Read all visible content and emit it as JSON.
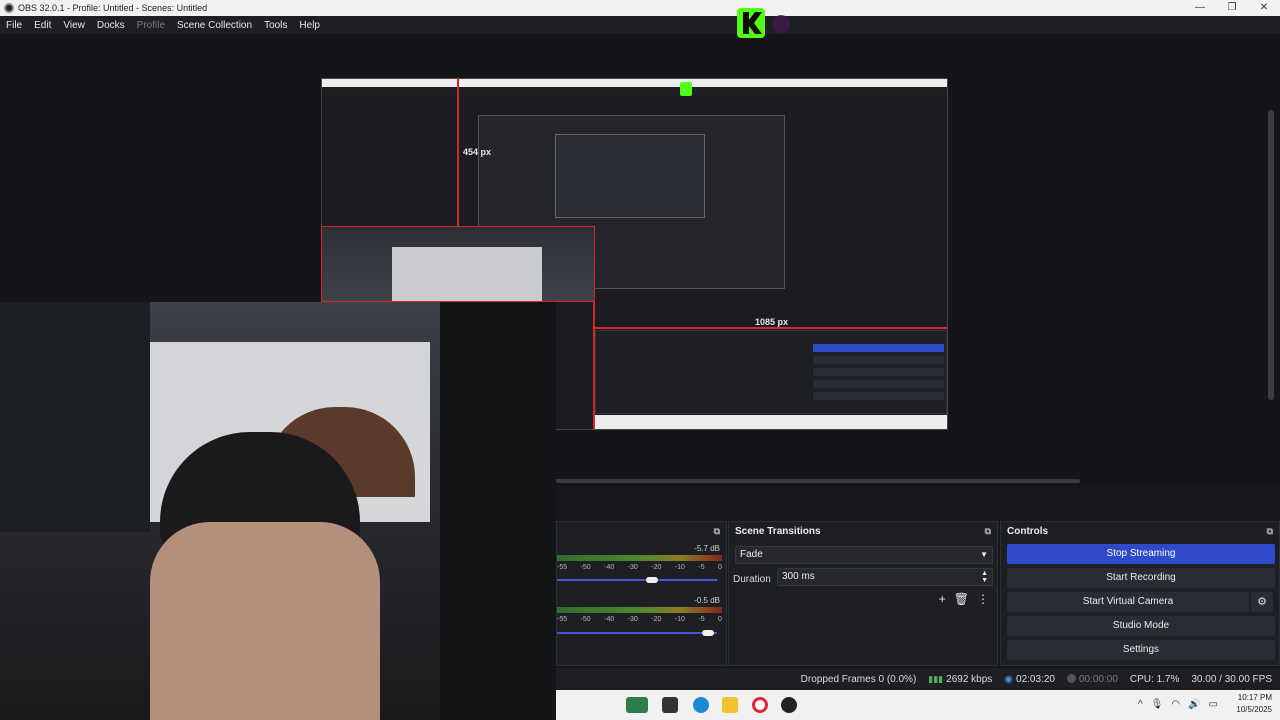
{
  "window": {
    "title": "OBS 32.0.1 - Profile: Untitled - Scenes: Untitled",
    "minimize": "—",
    "restore": "❐",
    "close": "✕"
  },
  "menu": [
    "File",
    "Edit",
    "View",
    "Docks",
    "Profile",
    "Scene Collection",
    "Tools",
    "Help"
  ],
  "preview": {
    "height_label": "454 px",
    "width_label": "1085 px"
  },
  "mixer": {
    "ticks": [
      "-55",
      "-50",
      "-40",
      "-30",
      "-20",
      "-10",
      "-5",
      "0"
    ],
    "track1_db": "-5.7 dB",
    "track2_db": "-0.5 dB"
  },
  "transitions": {
    "title": "Scene Transitions",
    "selected": "Fade",
    "duration_label": "Duration",
    "duration_value": "300 ms"
  },
  "controls": {
    "title": "Controls",
    "buttons": [
      "Stop Streaming",
      "Start Recording",
      "Start Virtual Camera",
      "Studio Mode",
      "Settings"
    ]
  },
  "status": {
    "dropped_frames": "Dropped Frames 0 (0.0%)",
    "bitrate": "2692 kbps",
    "stream_time": "02:03:20",
    "record_time": "00:00:00",
    "cpu": "CPU: 1.7%",
    "fps": "30.00 / 30.00 FPS"
  },
  "taskbar": {
    "time": "10:17 PM",
    "date": "10/5/2025"
  },
  "colors": {
    "accent": "#2e49c9",
    "selection": "#d9232e",
    "meter_green": "#4c8a2b"
  }
}
